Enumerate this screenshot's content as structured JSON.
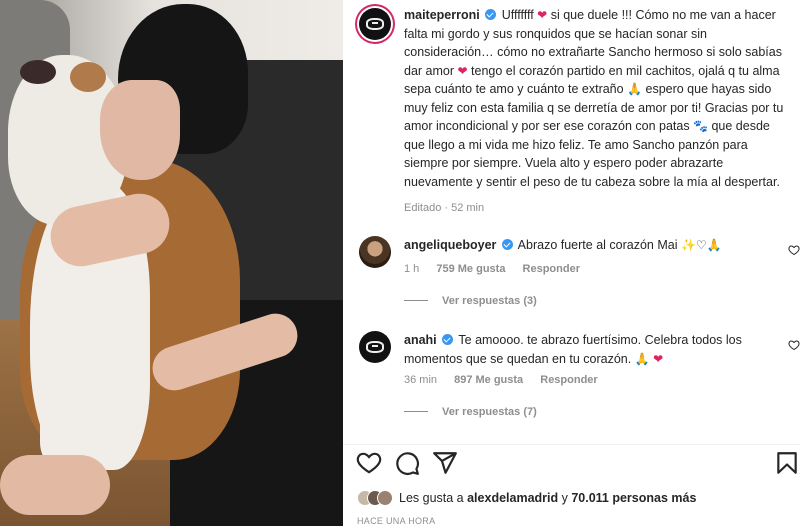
{
  "post": {
    "author": "maiteperroni",
    "caption_parts": [
      "Ufffffff ",
      "❤",
      " si que duele !!! Cómo no me van a hacer falta mi gordo y sus ronquidos que se hacían sonar sin consideración… cómo no extrañarte Sancho hermoso si solo sabías dar amor ",
      "❤",
      " tengo el corazón partido en mil cachitos, ojalá q tu alma sepa cuánto te amo y cuánto te extraño ",
      "🙏",
      " espero que hayas sido muy feliz con esta familia q se derretía de amor por ti! Gracias por tu amor incondicional y por ser ese corazón con patas ",
      "🐾",
      " que desde que llego a mi vida me hizo feliz. Te amo Sancho panzón para siempre por siempre. Vuela alto y espero poder abrazarte nuevamente y sentir el peso de tu cabeza sobre la mía al despertar."
    ],
    "edited": "Editado",
    "edited_time": "52 min"
  },
  "comments": [
    {
      "user": "angeliqueboyer",
      "text": "Abrazo fuerte al corazón Mai ",
      "emojis": "✨♡🙏",
      "time": "1 h",
      "likes": "759 Me gusta",
      "reply": "Responder",
      "view_replies": "Ver respuestas (3)"
    },
    {
      "user": "anahi",
      "text": "Te amoooo. te abrazo fuertísimo. Celebra todos los momentos que se quedan en tu corazón. ",
      "emojis": "🙏",
      "heart": "❤",
      "time": "36 min",
      "likes": "897 Me gusta",
      "reply": "Responder",
      "view_replies": "Ver respuestas (7)"
    }
  ],
  "footer": {
    "liked_prefix": "Les gusta a ",
    "liked_user": "alexdelamadrid",
    "liked_mid": " y ",
    "liked_count": "70.011 personas más",
    "time_ago": "HACE UNA HORA"
  },
  "icons": {
    "like": "heart-outline-icon",
    "comment": "comment-bubble-icon",
    "share": "paper-plane-icon",
    "save": "bookmark-icon",
    "verified": "verified-badge-icon"
  },
  "colors": {
    "verified": "#3897f0",
    "heart": "#e0245e",
    "muted": "#8e8e8e",
    "story_ring": "#d3286b"
  }
}
